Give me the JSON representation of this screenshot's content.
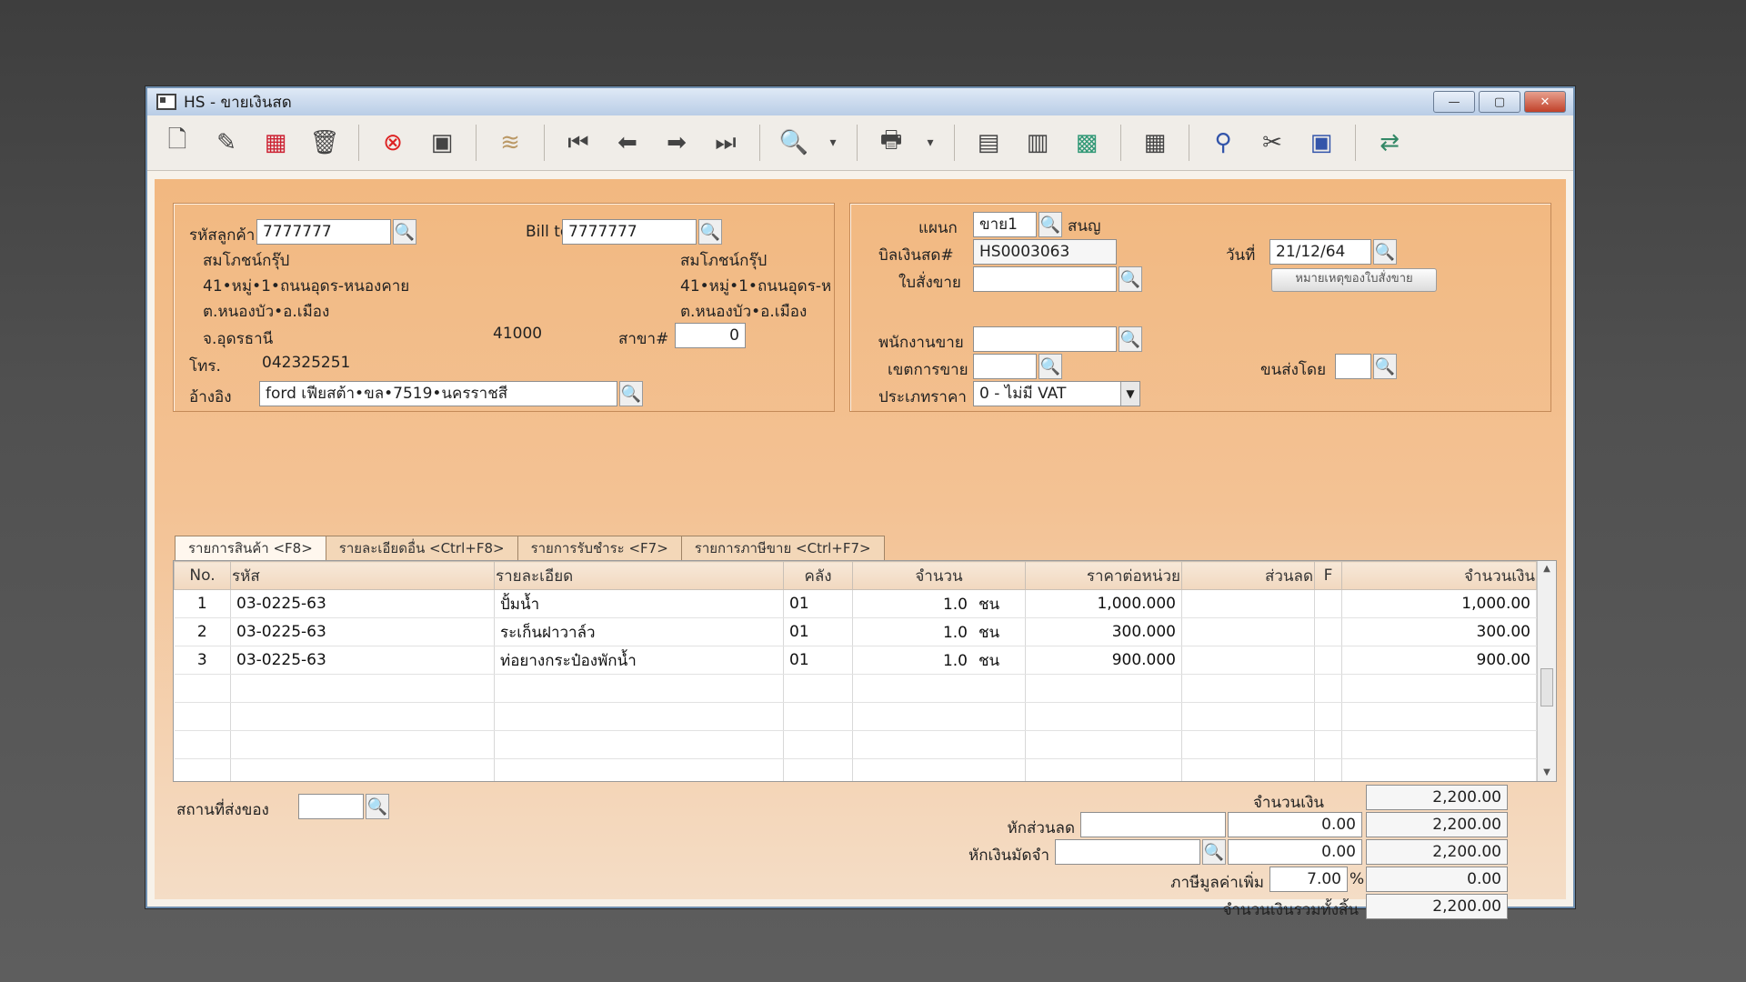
{
  "window": {
    "title": "HS - ขายเงินสด",
    "minimize": "—",
    "maximize": "▢",
    "close": "✕"
  },
  "toolbar": {
    "icons": [
      "new-doc-icon",
      "edit-icon",
      "void-icon",
      "delete-trash-icon",
      "cancel-icon",
      "save-icon",
      "stack-icon",
      "first-record-icon",
      "prev-record-icon",
      "next-record-icon",
      "last-record-icon",
      "search-doc-icon",
      "print-icon",
      "note-icon",
      "form-icon",
      "so-icon",
      "barcode-icon",
      "ok-stamp-icon",
      "approve-icon",
      "ok-doc-icon",
      "transfer-icon"
    ]
  },
  "customer": {
    "code_label": "รหัสลูกค้า",
    "code": "7777777",
    "name": "สมโภชน์กรุ๊ป",
    "addr1": "41•หมู่•1•ถนนอุดร-หนองคาย",
    "addr2": "ต.หนองบัว•อ.เมือง",
    "province": "จ.อุดรธานี",
    "postcode": "41000",
    "phone_label": "โทร.",
    "phone": "042325251",
    "ref_label": "อ้างอิง",
    "ref": "ford เฟียสต้า•ขล•7519•นครราชสี",
    "billto_label": "Bill to",
    "billto_code": "7777777",
    "billto_name": "สมโภชน์กรุ๊ป",
    "billto_addr1": "41•หมู่•1•ถนนอุดร-ห",
    "billto_addr2": "ต.หนองบัว•อ.เมือง",
    "branch_label": "สาขา#",
    "branch": "0"
  },
  "doc": {
    "dept_label": "แผนก",
    "dept": "ขาย1",
    "dept_name": "สนญ",
    "bill_label": "บิลเงินสด#",
    "bill_no": "HS0003063",
    "so_label": "ใบสั่งขาย",
    "so": "",
    "date_label": "วันที่",
    "date": "21/12/64",
    "so_note_button": "หมายเหตุของใบสั่งขาย",
    "salesman_label": "พนักงานขาย",
    "salesman": "",
    "area_label": "เขตการขาย",
    "area": "",
    "ship_by_label": "ขนส่งโดย",
    "ship_by": "",
    "price_type_label": "ประเภทราคา",
    "price_type": "0 - ไม่มี VAT"
  },
  "tabs": [
    "รายการสินค้า <F8>",
    "รายละเอียดอื่น <Ctrl+F8>",
    "รายการรับชำระ <F7>",
    "รายการภาษีขาย <Ctrl+F7>"
  ],
  "grid": {
    "headers": [
      "No.",
      "รหัส",
      "รายละเอียด",
      "คลัง",
      "จำนวน",
      "ราคาต่อหน่วย",
      "ส่วนลด",
      "F",
      "จำนวนเงิน"
    ],
    "rows": [
      {
        "no": "1",
        "code": "03-0225-63",
        "desc": "ปั้มน้ำ",
        "wh": "01",
        "qty": "1.0",
        "unit": "ชน",
        "price": "1,000.000",
        "disc": "",
        "f": "",
        "amount": "1,000.00"
      },
      {
        "no": "2",
        "code": "03-0225-63",
        "desc": "ระเก็นฝาวาล์ว",
        "wh": "01",
        "qty": "1.0",
        "unit": "ชน",
        "price": "300.000",
        "disc": "",
        "f": "",
        "amount": "300.00"
      },
      {
        "no": "3",
        "code": "03-0225-63",
        "desc": "ท่อยางกระป๋องพักน้ำ",
        "wh": "01",
        "qty": "1.0",
        "unit": "ชน",
        "price": "900.000",
        "disc": "",
        "f": "",
        "amount": "900.00"
      }
    ]
  },
  "footer": {
    "ship_place_label": "สถานที่ส่งของ",
    "ship_place": "",
    "amount_label": "จำนวนเงิน",
    "amount": "2,200.00",
    "discount_label": "หักส่วนลด",
    "discount_text": "",
    "discount_value": "0.00",
    "after_discount": "2,200.00",
    "deposit_label": "หักเงินมัดจำ",
    "deposit_text": "",
    "deposit_value": "0.00",
    "after_deposit": "2,200.00",
    "vat_label": "ภาษีมูลค่าเพิ่ม",
    "vat_rate": "7.00",
    "vat_pct": "%",
    "vat_amount": "0.00",
    "grand_total_label": "จำนวนเงินรวมทั้งสิ้น",
    "grand_total": "2,200.00"
  }
}
